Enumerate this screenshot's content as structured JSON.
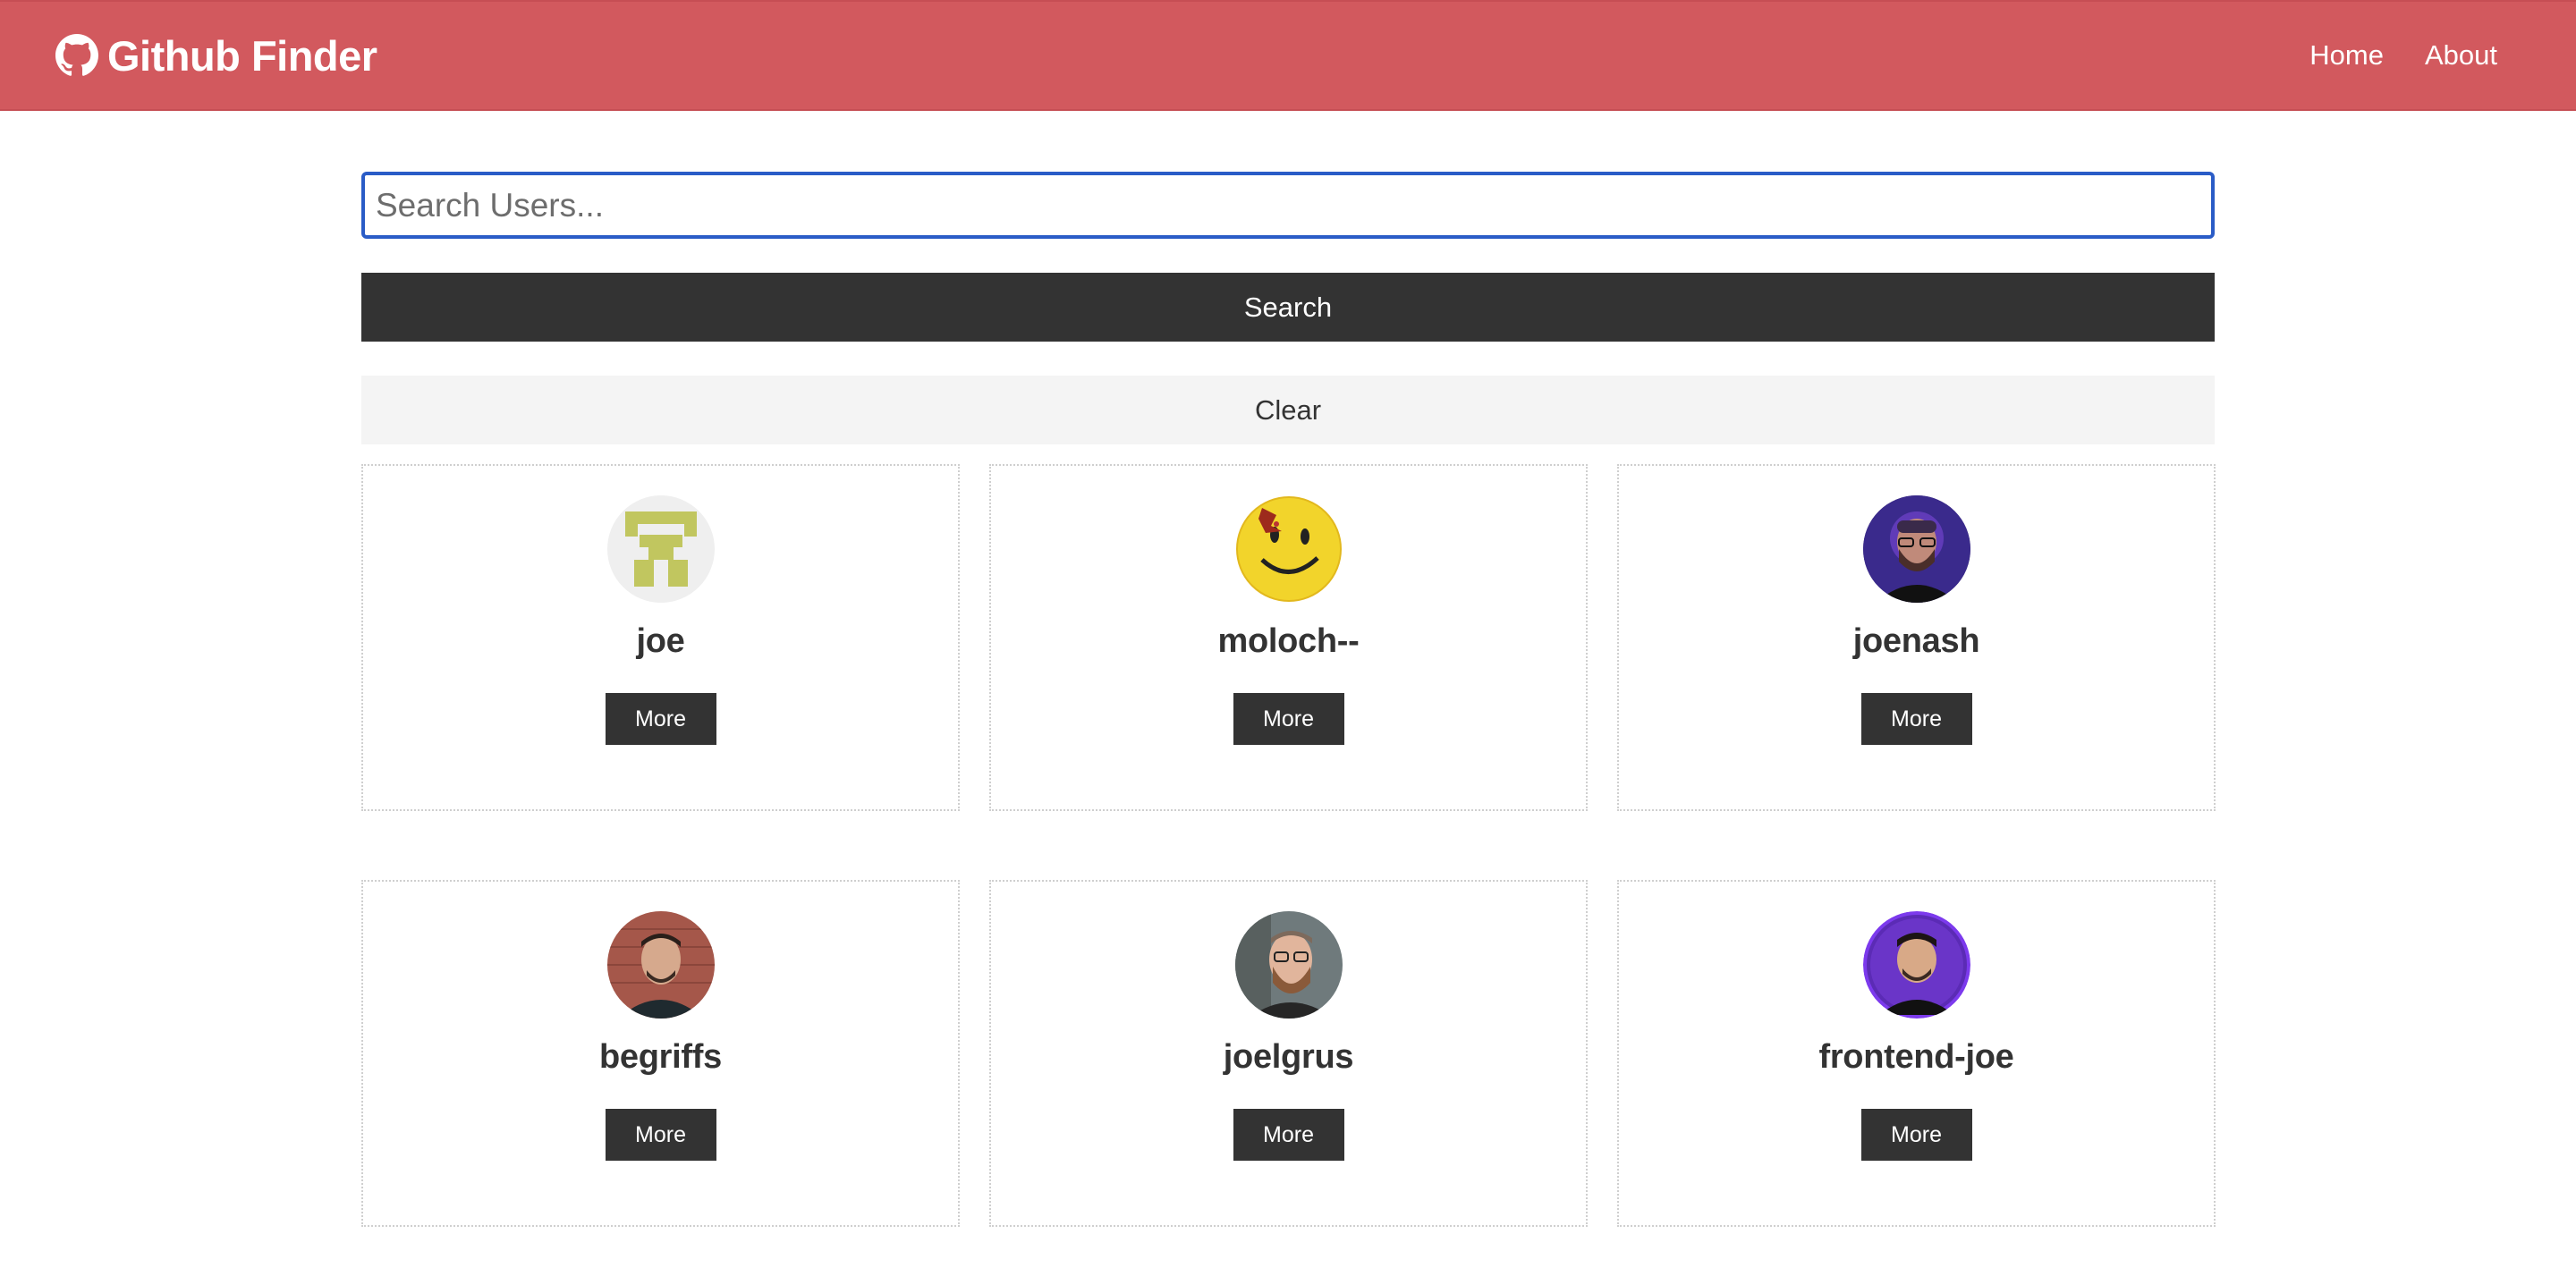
{
  "navbar": {
    "brand_icon": "github-icon",
    "title": "Github Finder",
    "links": [
      {
        "label": "Home"
      },
      {
        "label": "About"
      }
    ],
    "background_color": "#d2595e"
  },
  "search": {
    "placeholder": "Search Users...",
    "value": "",
    "submit_label": "Search",
    "clear_label": "Clear"
  },
  "users": [
    {
      "login": "joe",
      "avatar": "identicon-avatar",
      "more_label": "More"
    },
    {
      "login": "moloch--",
      "avatar": "smiley-avatar",
      "more_label": "More"
    },
    {
      "login": "joenash",
      "avatar": "photo-avatar",
      "more_label": "More"
    },
    {
      "login": "begriffs",
      "avatar": "photo-avatar",
      "more_label": "More"
    },
    {
      "login": "joelgrus",
      "avatar": "photo-avatar",
      "more_label": "More"
    },
    {
      "login": "frontend-joe",
      "avatar": "photo-avatar",
      "more_label": "More"
    }
  ]
}
